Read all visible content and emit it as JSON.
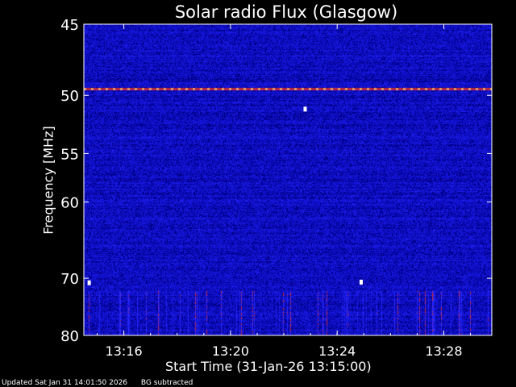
{
  "chart_data": {
    "type": "heatmap",
    "title": "Solar radio Flux (Glasgow)",
    "xlabel": "Start Time (31-Jan-26 13:15:00)",
    "ylabel": "Frequency [MHz]",
    "x_range_minutes_after_13_00": [
      14.5,
      29.8
    ],
    "x_ticks": [
      {
        "value": 16,
        "label": "13:16"
      },
      {
        "value": 20,
        "label": "13:20"
      },
      {
        "value": 24,
        "label": "13:24"
      },
      {
        "value": 28,
        "label": "13:28"
      }
    ],
    "y_range": [
      45,
      80
    ],
    "y_ticks": [
      45,
      50,
      55,
      60,
      70,
      80
    ],
    "y_scale": "reciprocal",
    "grid": false,
    "colormap": [
      "#000080",
      "#1a1ad0",
      "#3a3aff",
      "#c82828",
      "#ffd060",
      "#ffffff"
    ],
    "features": [
      {
        "type": "persistent-line",
        "frequency_mhz": 49.5,
        "intensity": "high"
      },
      {
        "type": "band",
        "frequency_range_mhz": [
          72,
          80
        ],
        "intensity": "striated"
      },
      {
        "type": "spike",
        "time": 22.8,
        "frequency_mhz": 51.1
      },
      {
        "type": "spike",
        "time": 24.9,
        "frequency_mhz": 70.6
      },
      {
        "type": "spike",
        "time": 14.7,
        "frequency_mhz": 70.7
      }
    ]
  },
  "footer": {
    "updated": "Updated Sat Jan 31 14:01:50 2026",
    "note": "BG subtracted"
  }
}
